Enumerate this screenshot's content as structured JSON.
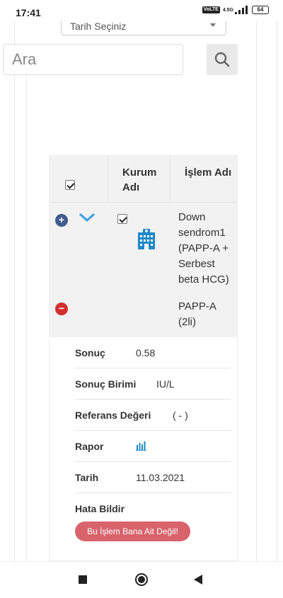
{
  "status": {
    "time": "17:41",
    "network": "4.5G",
    "volte": "VoLTE",
    "battery": "64"
  },
  "filters": {
    "date_placeholder": "Tarih Seçiniz",
    "search_placeholder": "Ara"
  },
  "table": {
    "columns": [
      "Kurum Adı",
      "İşlem Adı"
    ],
    "rows": [
      {
        "name": "Down sendrom1 (PAPP-A + Serbest beta HCG)",
        "checked": true
      },
      {
        "name": "PAPP-A (2li)"
      }
    ]
  },
  "detail": {
    "sonuc_label": "Sonuç",
    "sonuc_value": "0.58",
    "birim_label": "Sonuç Birimi",
    "birim_value": "IU/L",
    "referans_label": "Referans Değeri",
    "referans_value": "( - )",
    "rapor_label": "Rapor",
    "tarih_label": "Tarih",
    "tarih_value": "11.03.2021",
    "hata_label": "Hata Bildir",
    "hata_button": "Bu İşlem Bana Ait Değil!"
  },
  "colors": {
    "accent_blue": "#3f5d8f",
    "danger": "#d32f2f",
    "report_button": "#d9636b",
    "chevron": "#4aa3df",
    "building": "#1e88c8"
  }
}
